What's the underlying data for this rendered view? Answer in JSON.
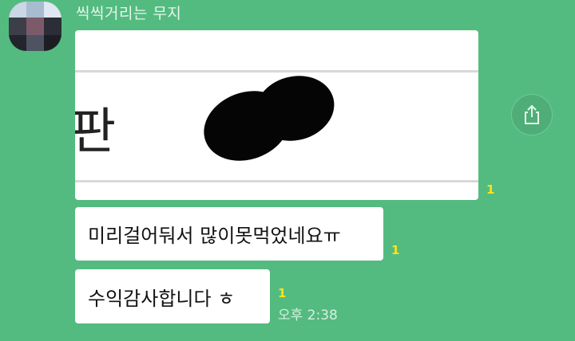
{
  "sender": {
    "name": "씩씩거리는 무지"
  },
  "messages": [
    {
      "type": "image",
      "visible_text": "판",
      "unread": "1"
    },
    {
      "type": "text",
      "text": "미리걸어둬서 많이못먹었네요ㅠ",
      "unread": "1"
    },
    {
      "type": "text",
      "text": "수익감사합니다 ㅎ",
      "unread": "1",
      "time": "오후 2:38"
    }
  ],
  "icons": {
    "share": "share-icon"
  },
  "colors": {
    "background": "#54bb80",
    "bubble": "#ffffff",
    "unread": "#ffe21a"
  }
}
